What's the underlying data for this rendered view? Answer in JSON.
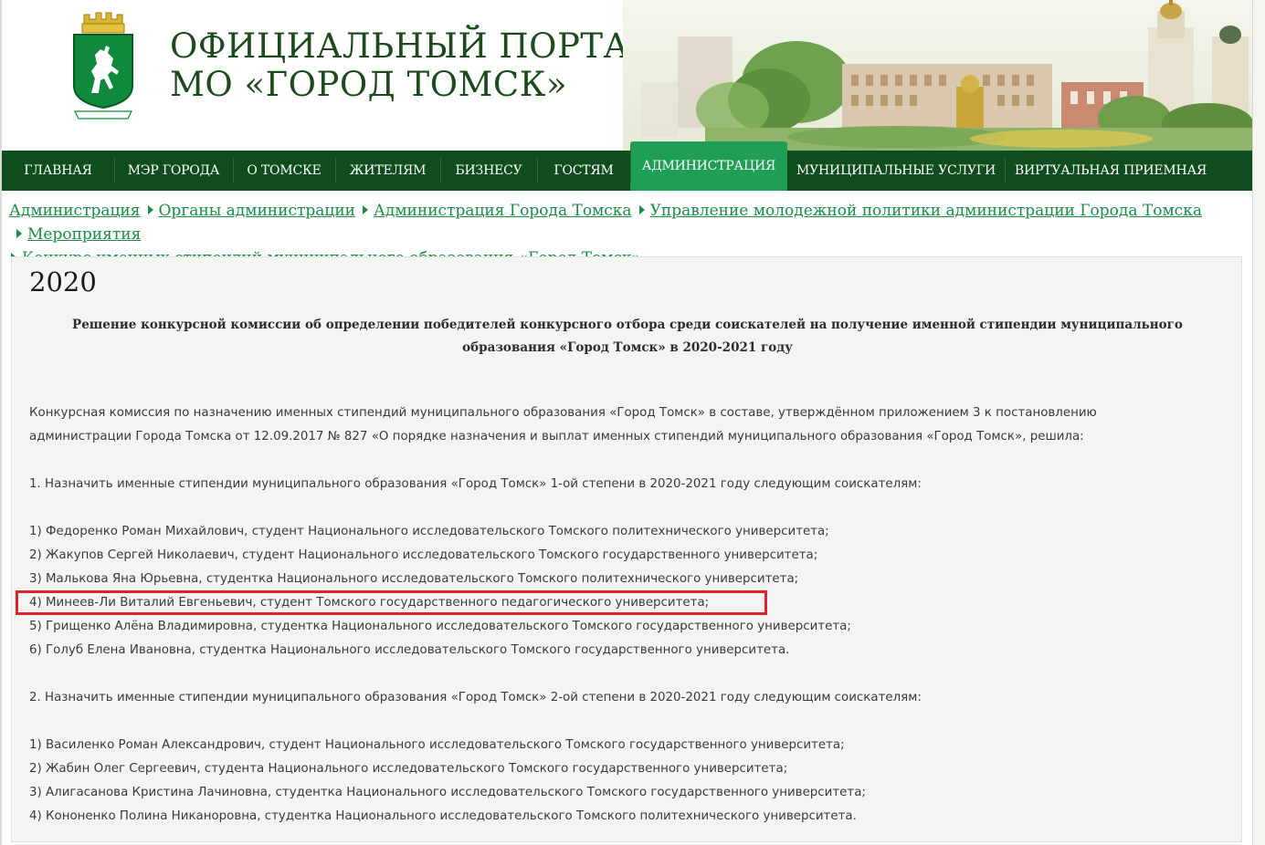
{
  "header": {
    "title_line1": "ОФИЦИАЛЬНЫЙ ПОРТАЛ",
    "title_line2": "МО «ГОРОД ТОМСК»"
  },
  "nav": {
    "items": [
      {
        "label": "ГЛАВНАЯ"
      },
      {
        "label": "МЭР ГОРОДА"
      },
      {
        "label": "О ТОМСКЕ"
      },
      {
        "label": "ЖИТЕЛЯМ"
      },
      {
        "label": "БИЗНЕСУ"
      },
      {
        "label": "ГОСТЯМ"
      },
      {
        "label": "АДМИНИСТРАЦИЯ",
        "active": true
      },
      {
        "label": "МУНИЦИПАЛЬНЫЕ УСЛУГИ"
      },
      {
        "label": "ВИРТУАЛЬНАЯ ПРИЕМНАЯ"
      }
    ]
  },
  "breadcrumb": [
    "Администрация",
    "Органы администрации",
    "Администрация Города Томска",
    "Управление молодежной политики администрации Города Томска",
    "Мероприятия",
    "Конкурс именных стипендий муниципального образования «Город Томск»"
  ],
  "content": {
    "heading": "2020",
    "decision_title": "Решение конкурсной комиссии об определении победителей конкурсного отбора среди соискателей на получение именной стипендии муниципального образования «Город Томск» в 2020-2021 году",
    "intro_line1": "Конкурсная комиссия по назначению именных стипендий муниципального образования «Город Томск» в составе, утверждённом приложением 3 к постановлению",
    "intro_line2": "администрации Города Томска от 12.09.2017 № 827 «О порядке назначения и выплат именных стипендий муниципального образования «Город Томск», решила:",
    "section1_title": "1. Назначить именные стипендии муниципального образования «Город Томск» 1-ой степени в 2020-2021 году следующим соискателям:",
    "section1_items": [
      "1) Федоренко Роман Михайлович, студент Национального исследовательского Томского политехнического университета;",
      "2) Жакупов Сергей Николаевич, студент Национального исследовательского Томского государственного университета;",
      "3) Малькова Яна Юрьевна, студентка Национального исследовательского Томского политехнического университета;",
      "4) Минеев-Ли Виталий Евгеньевич, студент Томского государственного педагогического университета;",
      "5) Грищенко Алёна Владимировна, студентка Национального исследовательского Томского государственного университета;",
      "6) Голуб Елена Ивановна, студентка Национального исследовательского Томского государственного университета."
    ],
    "section2_title": "2. Назначить именные стипендии муниципального образования «Город Томск» 2-ой степени в 2020-2021 году следующим соискателям:",
    "section2_items": [
      "1) Василенко Роман Александрович, студент Национального исследовательского Томского государственного университета;",
      "2) Жабин Олег Сергеевич, студента Национального исследовательского Томского государственного университета;",
      "3) Алигасанова Кристина Лачиновна, студентка Национального исследовательского Томского государственного университета;",
      "4) Кононенко Полина Никаноровна, студентка Национального исследовательского Томского политехнического университета."
    ]
  },
  "colors": {
    "nav_bg": "#0f4d1e",
    "nav_active": "#1f9e55",
    "link": "#1a8c44",
    "title_green": "#1d4a1c",
    "highlight": "#e0222c"
  }
}
